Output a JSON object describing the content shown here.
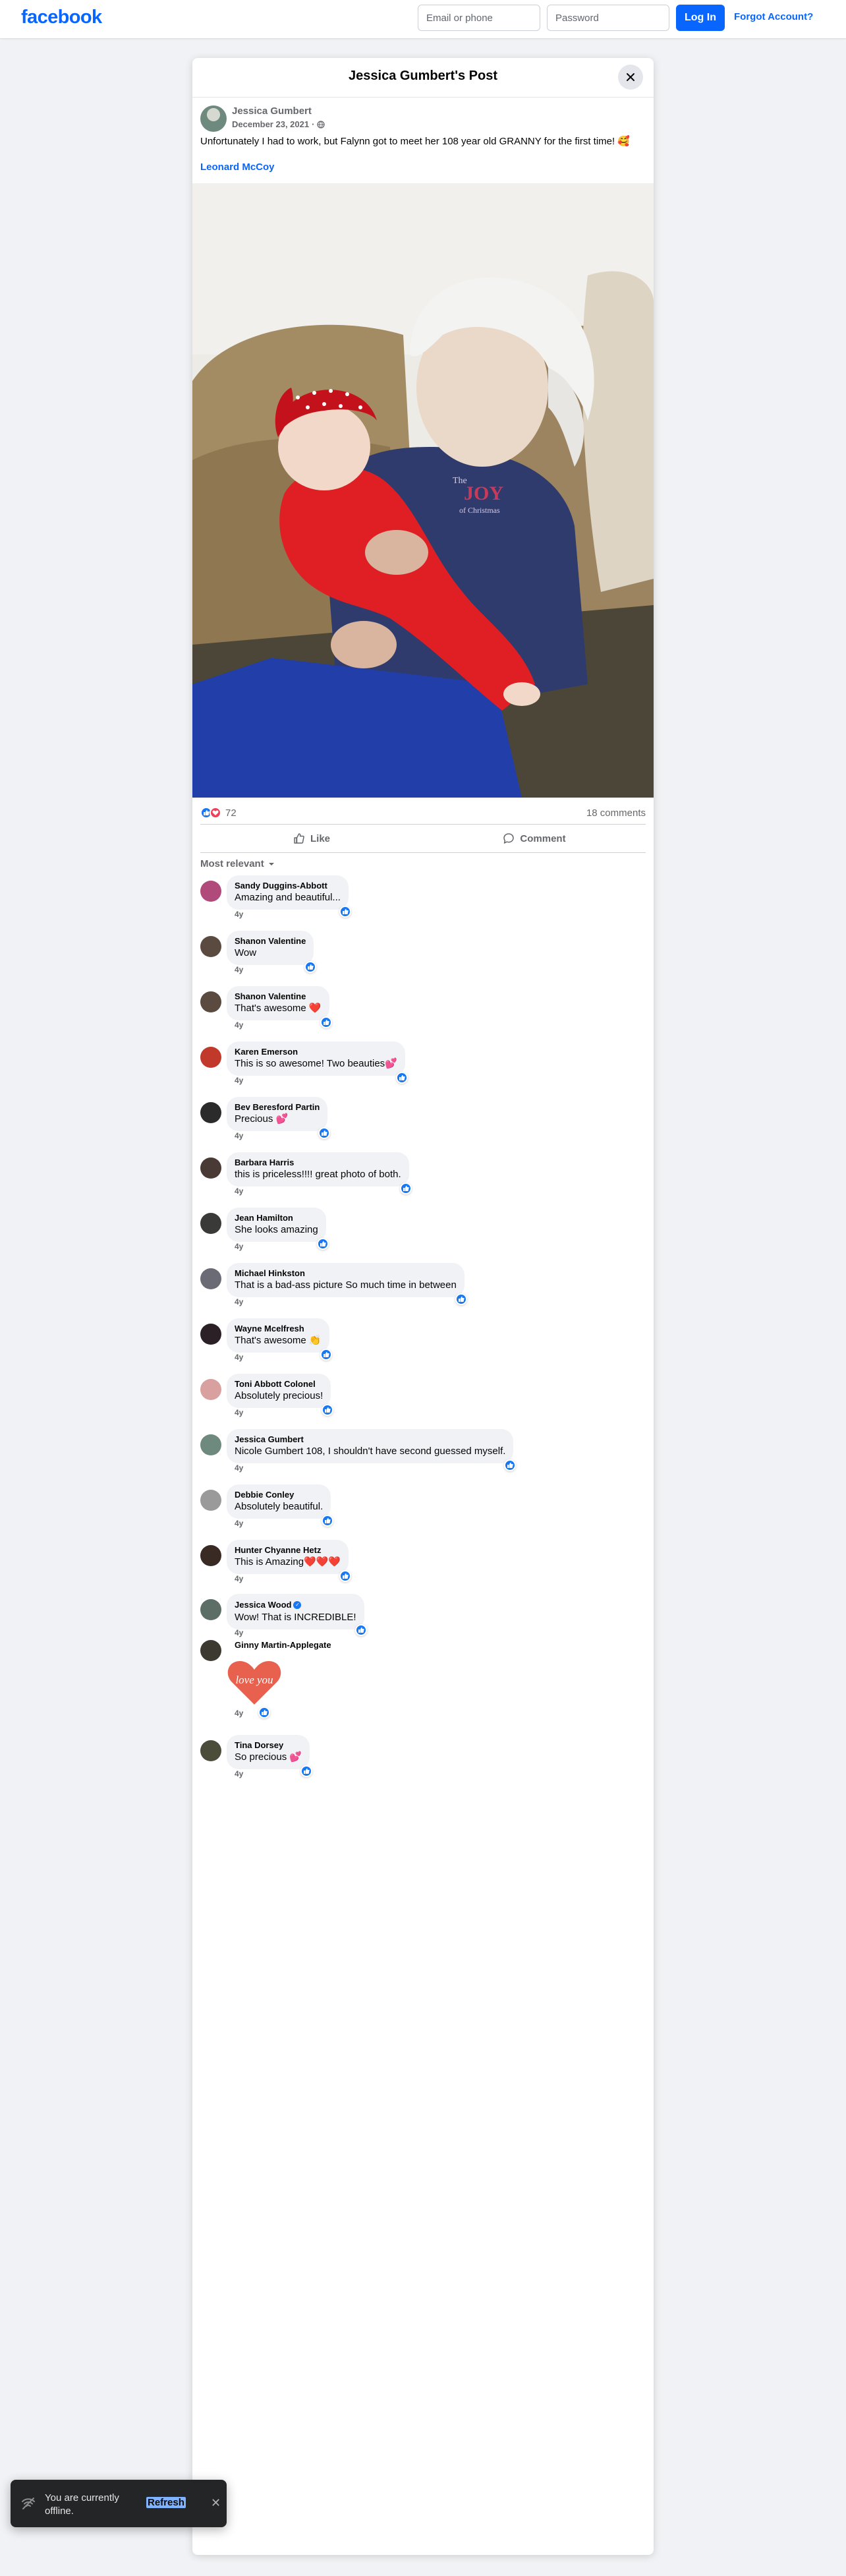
{
  "topbar": {
    "logo": "facebook",
    "email_placeholder": "Email or phone",
    "password_placeholder": "Password",
    "login_label": "Log In",
    "forgot_label": "Forgot Account?",
    "brand_color": "#0866ff"
  },
  "post": {
    "dialog_title": "Jessica Gumbert's Post",
    "close_icon": "close-icon",
    "author": "Jessica Gumbert",
    "date": "December 23, 2021",
    "separator": "·",
    "privacy_icon": "globe-icon",
    "text": "Unfortunately I had to work, but Falynn got to meet her 108 year old GRANNY for the first time! 🥰",
    "tagged": "Leonard McCoy",
    "photo_shirt_text_1": "The",
    "photo_shirt_text_2": "JOY",
    "photo_shirt_text_3": "of Christmas",
    "reaction_count": "72",
    "comment_count": "18 comments",
    "like_label": "Like",
    "comment_label": "Comment",
    "filter_label": "Most relevant"
  },
  "comments": [
    {
      "name": "Sandy Duggins-Abbott",
      "text": "Amazing and beautiful...",
      "time": "4y",
      "avatar_color": "#b04a7a"
    },
    {
      "name": "Shanon Valentine",
      "text": "Wow",
      "time": "4y",
      "avatar_color": "#5a4a40"
    },
    {
      "name": "Shanon Valentine",
      "text": "That's awesome ❤️",
      "time": "4y",
      "avatar_color": "#5a4a40"
    },
    {
      "name": "Karen Emerson",
      "text": "This is so awesome! Two beauties💕",
      "time": "4y",
      "avatar_color": "#c0392b"
    },
    {
      "name": "Bev Beresford Partin",
      "text": "Precious 💕",
      "time": "4y",
      "avatar_color": "#2b2b2b"
    },
    {
      "name": "Barbara Harris",
      "text": "this is priceless!!!! great photo of both.",
      "time": "4y",
      "avatar_color": "#4a3a36"
    },
    {
      "name": "Jean Hamilton",
      "text": "She looks amazing",
      "time": "4y",
      "avatar_color": "#3a3a38"
    },
    {
      "name": "Michael Hinkston",
      "text": "That is a bad-ass picture So much time in between",
      "time": "4y",
      "avatar_color": "#6b6b75"
    },
    {
      "name": "Wayne Mcelfresh",
      "text": "That's awesome 👏",
      "time": "4y",
      "avatar_color": "#2a2026"
    },
    {
      "name": "Toni Abbott Colonel",
      "text": "Absolutely precious!",
      "time": "4y",
      "avatar_color": "#d9a0a0"
    },
    {
      "name": "Jessica Gumbert",
      "text": "Nicole Gumbert 108, I shouldn't have second guessed myself.",
      "time": "4y",
      "avatar_color": "#6e8a7e"
    },
    {
      "name": "Debbie Conley",
      "text": "Absolutely beautiful.",
      "time": "4y",
      "avatar_color": "#9a9a9a"
    },
    {
      "name": "Hunter Chyanne Hetz",
      "text": "This is Amazing❤️❤️❤️",
      "time": "4y",
      "avatar_color": "#3a2a24"
    },
    {
      "name": "Jessica Wood",
      "text": "Wow! That is INCREDIBLE!",
      "time": "4y",
      "avatar_color": "#5c6e66"
    },
    {
      "name": "Ginny Martin-Applegate",
      "text": "",
      "time": "4y",
      "avatar_color": "#3c3a30",
      "sticker": "love you"
    },
    {
      "name": "Tina Dorsey",
      "text": "So precious 💕",
      "time": "4y",
      "avatar_color": "#4c4c3a"
    }
  ],
  "toast": {
    "message": "You are currently offline.",
    "refresh_label": "Refresh",
    "icon": "wifi-off-icon"
  }
}
